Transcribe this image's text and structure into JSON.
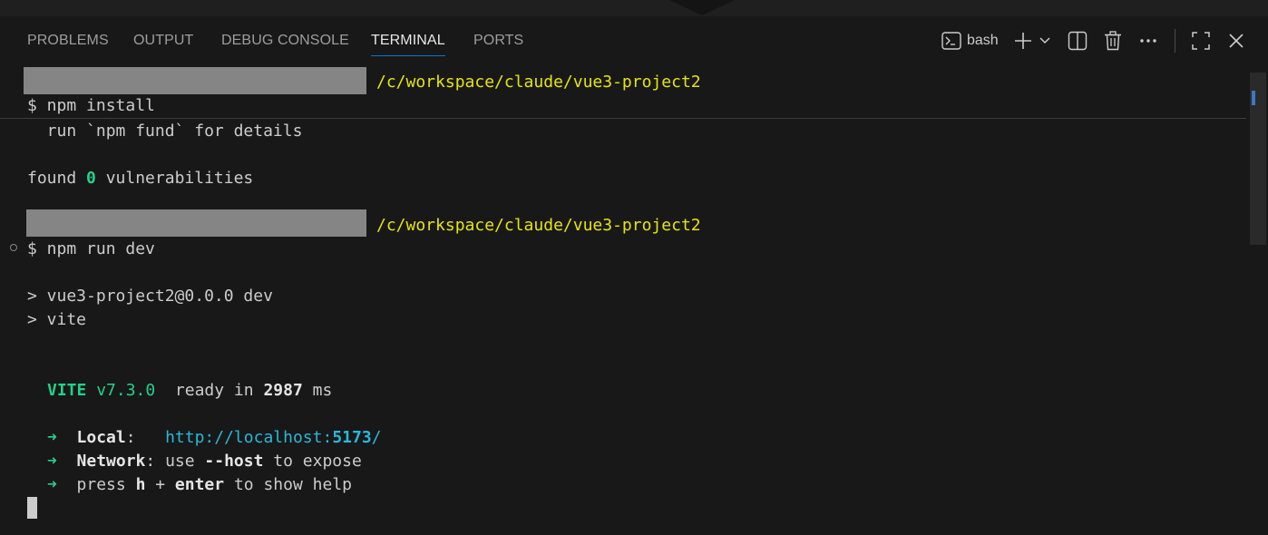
{
  "panel": {
    "tabs": [
      {
        "label": "PROBLEMS"
      },
      {
        "label": "OUTPUT"
      },
      {
        "label": "DEBUG CONSOLE"
      },
      {
        "label": "TERMINAL"
      },
      {
        "label": "PORTS"
      }
    ],
    "active_tab": "TERMINAL",
    "terminal_name": "bash",
    "actions": [
      "terminal-icon",
      "plus-icon",
      "chevron-down-icon",
      "split-icon",
      "trash-icon",
      "more-icon",
      "maximize-icon",
      "close-icon"
    ]
  },
  "terminal": {
    "prompt1_path": "/c/workspace/claude/vue3-project2",
    "cmd1": "$ npm install",
    "fund_line": "  run `npm fund` for details",
    "found_pre": "found ",
    "found_count": "0",
    "found_post": " vulnerabilities",
    "prompt2_path": "/c/workspace/claude/vue3-project2",
    "cmd2": "$ npm run dev",
    "script_line1": "> vue3-project2@0.0.0 dev",
    "script_line2": "> vite",
    "vite_name": "VITE",
    "vite_version": "v7.3.0",
    "ready_pre": "  ready in ",
    "ready_ms": "2987",
    "ready_post": " ms",
    "arrow": "➜",
    "local_label": "Local",
    "local_url_pre": "http://localhost:",
    "local_port": "5173",
    "local_url_post": "/",
    "network_label": "Network",
    "network_pre": ": use ",
    "network_flag": "--host",
    "network_post": " to expose",
    "help_pre": "press ",
    "help_key1": "h",
    "help_plus": " + ",
    "help_key2": "enter",
    "help_post": " to show help"
  },
  "colors": {
    "path": "#e5e510",
    "success": "#23d18b",
    "link": "#29b8db",
    "accent": "#0078d4"
  }
}
